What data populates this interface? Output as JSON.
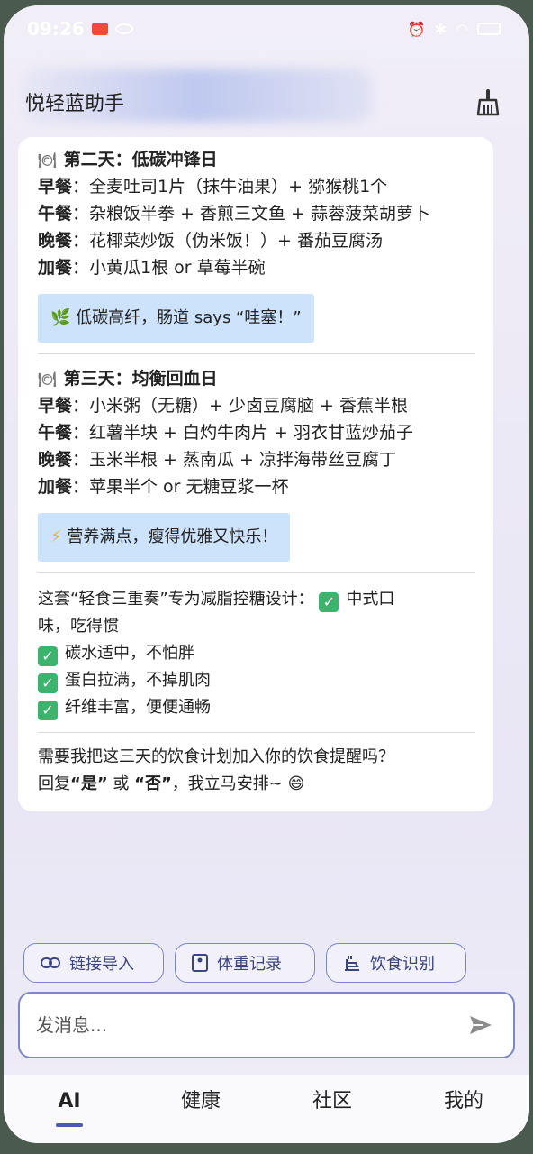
{
  "status": {
    "time": "09:26"
  },
  "header": {
    "title": "悦轻蓝助手"
  },
  "day2": {
    "title": "第二天：低碳冲锋日",
    "meals": [
      {
        "label": "早餐",
        "text": "：全麦吐司1片（抹牛油果）+ 猕猴桃1个"
      },
      {
        "label": "午餐",
        "text": "：杂粮饭半拳 + 香煎三文鱼 + 蒜蓉菠菜胡萝卜"
      },
      {
        "label": "晚餐",
        "text": "：花椰菜炒饭（伪米饭！）+ 番茄豆腐汤"
      },
      {
        "label": "加餐",
        "text": "：小黄瓜1根 or 草莓半碗"
      }
    ],
    "tip_icon": "🌿",
    "tip": "低碳高纤，肠道 says “哇塞！”"
  },
  "day3": {
    "title": "第三天：均衡回血日",
    "meals": [
      {
        "label": "早餐",
        "text": "：小米粥（无糖）+ 少卤豆腐脑 + 香蕉半根"
      },
      {
        "label": "午餐",
        "text": "：红薯半块 + 白灼牛肉片 + 羽衣甘蓝炒茄子"
      },
      {
        "label": "晚餐",
        "text": "：玉米半根 + 蒸南瓜 + 凉拌海带丝豆腐丁"
      },
      {
        "label": "加餐",
        "text": "：苹果半个 or 无糖豆浆一杯"
      }
    ],
    "tip_icon": "⚡",
    "tip": "营养满点，瘦得优雅又快乐！"
  },
  "summary": {
    "intro": "这套“轻食三重奏”专为减脂控糖设计：",
    "first_point": "中式口",
    "first_point_cont": "味，吃得惯",
    "points": [
      "碳水适中，不怕胖",
      "蛋白拉满，不掉肌肉",
      "纤维丰富，便便通畅"
    ]
  },
  "closing": {
    "line1": "需要我把这三天的饮食计划加入你的饮食提醒吗？",
    "line2_prefix": "回复",
    "yes": "“是”",
    "or": " 或 ",
    "no": "“否”",
    "line2_suffix": "，我立马安排~ 😄"
  },
  "chips": [
    {
      "label": "链接导入",
      "icon": "link-icon"
    },
    {
      "label": "体重记录",
      "icon": "scale-icon"
    },
    {
      "label": "饮食识别",
      "icon": "food-scan-icon"
    }
  ],
  "input": {
    "placeholder": "发消息..."
  },
  "tabs": [
    {
      "label": "AI",
      "active": true
    },
    {
      "label": "健康"
    },
    {
      "label": "社区"
    },
    {
      "label": "我的"
    }
  ],
  "colors": {
    "accent": "#4b59b0",
    "tip_bg": "#cde3fb",
    "check": "#3cb46e"
  }
}
